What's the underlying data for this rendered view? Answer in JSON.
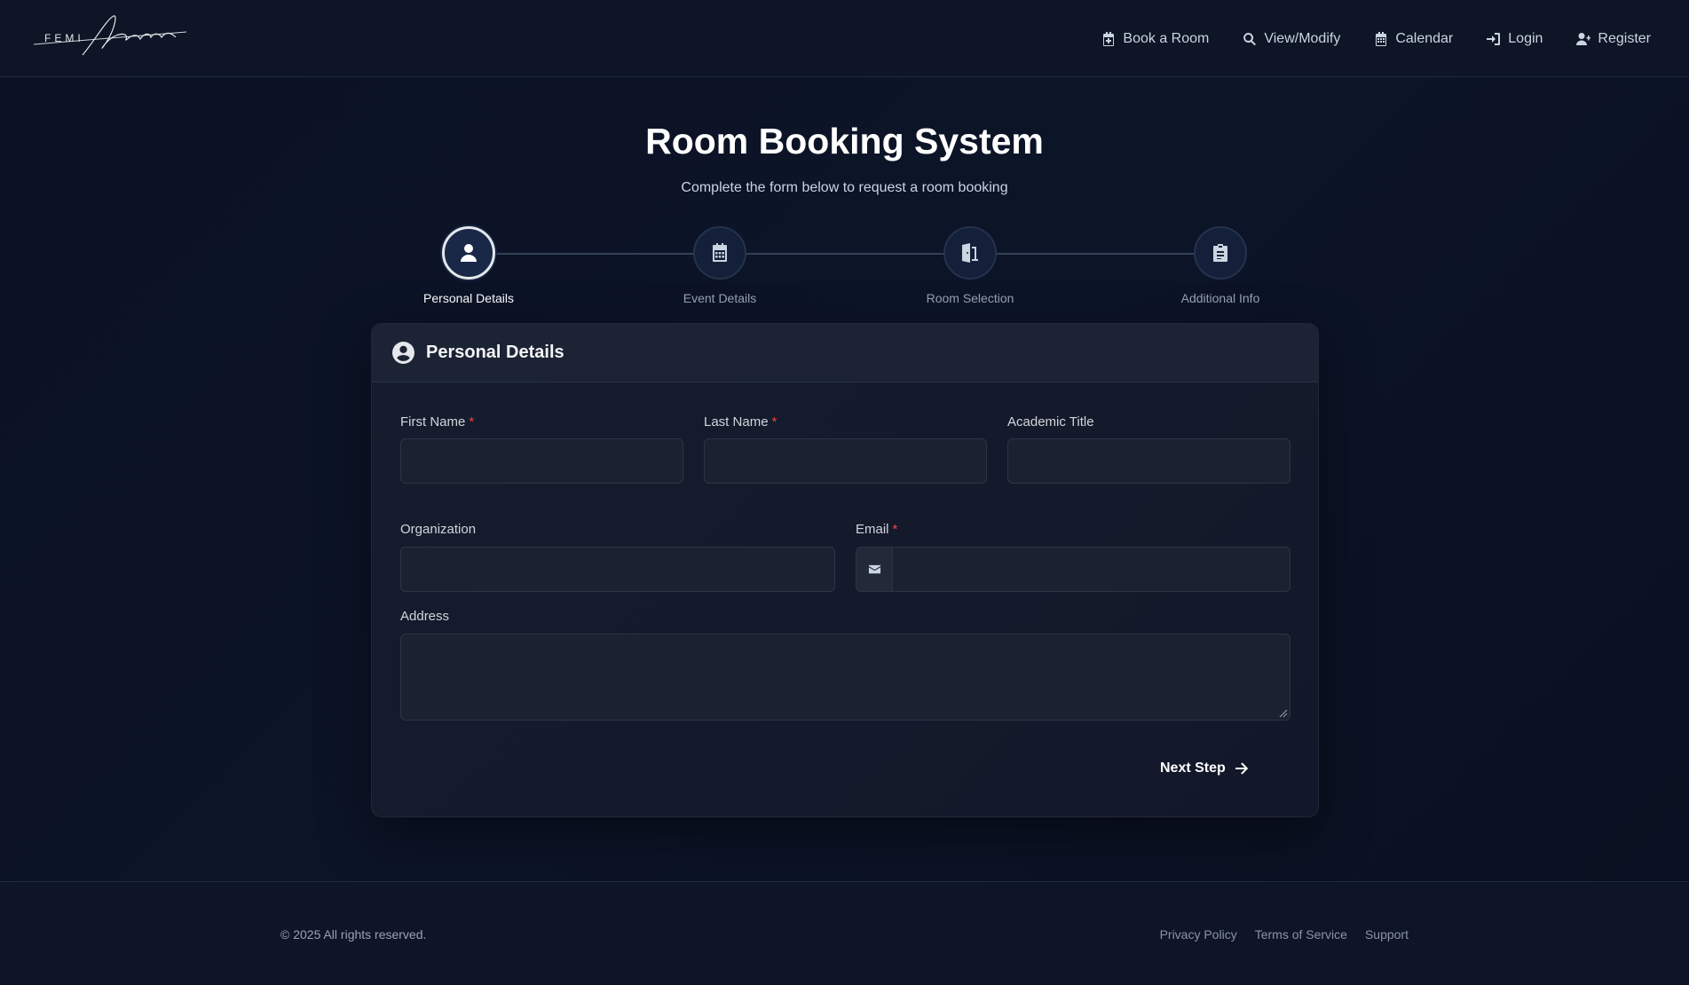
{
  "header": {
    "logo_text": "FEMI",
    "logo_signature": "Akinlosotu",
    "nav": [
      {
        "label": "Book a Room",
        "icon": "calendar-plus-icon"
      },
      {
        "label": "View/Modify",
        "icon": "search-icon"
      },
      {
        "label": "Calendar",
        "icon": "calendar-icon"
      },
      {
        "label": "Login",
        "icon": "sign-in-icon"
      },
      {
        "label": "Register",
        "icon": "user-plus-icon"
      }
    ]
  },
  "hero": {
    "title": "Room Booking System",
    "subtitle": "Complete the form below to request a room booking"
  },
  "stepper": {
    "active_index": 0,
    "steps": [
      {
        "label": "Personal Details",
        "icon": "user-icon"
      },
      {
        "label": "Event Details",
        "icon": "calendar-icon"
      },
      {
        "label": "Room Selection",
        "icon": "door-icon"
      },
      {
        "label": "Additional Info",
        "icon": "clipboard-icon"
      }
    ]
  },
  "form": {
    "section_title": "Personal Details",
    "section_icon": "user-circle-icon",
    "fields": {
      "first_name": {
        "label": "First Name",
        "required_mark": "*",
        "value": ""
      },
      "last_name": {
        "label": "Last Name",
        "required_mark": "*",
        "value": ""
      },
      "academic_title": {
        "label": "Academic Title",
        "value": ""
      },
      "organization": {
        "label": "Organization",
        "value": ""
      },
      "email": {
        "label": "Email",
        "required_mark": "*",
        "value": "",
        "addon_icon": "envelope-icon"
      },
      "address": {
        "label": "Address",
        "value": ""
      }
    },
    "next_label": "Next Step"
  },
  "footer": {
    "copyright": "© 2025 All rights reserved.",
    "links": [
      "Privacy Policy",
      "Terms of Service",
      "Support"
    ]
  },
  "colors": {
    "background": "#0b1224",
    "card": "#151c2e",
    "required": "#ef4444",
    "text": "#e5e7eb"
  }
}
